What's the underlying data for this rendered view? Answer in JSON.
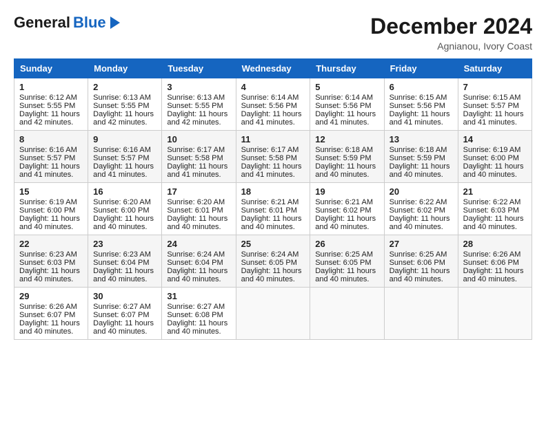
{
  "header": {
    "logo_general": "General",
    "logo_blue": "Blue",
    "month_title": "December 2024",
    "location": "Agnianou, Ivory Coast"
  },
  "days_of_week": [
    "Sunday",
    "Monday",
    "Tuesday",
    "Wednesday",
    "Thursday",
    "Friday",
    "Saturday"
  ],
  "weeks": [
    [
      {
        "day": "1",
        "sunrise": "6:12 AM",
        "sunset": "5:55 PM",
        "daylight": "11 hours and 42 minutes."
      },
      {
        "day": "2",
        "sunrise": "6:13 AM",
        "sunset": "5:55 PM",
        "daylight": "11 hours and 42 minutes."
      },
      {
        "day": "3",
        "sunrise": "6:13 AM",
        "sunset": "5:55 PM",
        "daylight": "11 hours and 42 minutes."
      },
      {
        "day": "4",
        "sunrise": "6:14 AM",
        "sunset": "5:56 PM",
        "daylight": "11 hours and 41 minutes."
      },
      {
        "day": "5",
        "sunrise": "6:14 AM",
        "sunset": "5:56 PM",
        "daylight": "11 hours and 41 minutes."
      },
      {
        "day": "6",
        "sunrise": "6:15 AM",
        "sunset": "5:56 PM",
        "daylight": "11 hours and 41 minutes."
      },
      {
        "day": "7",
        "sunrise": "6:15 AM",
        "sunset": "5:57 PM",
        "daylight": "11 hours and 41 minutes."
      }
    ],
    [
      {
        "day": "8",
        "sunrise": "6:16 AM",
        "sunset": "5:57 PM",
        "daylight": "11 hours and 41 minutes."
      },
      {
        "day": "9",
        "sunrise": "6:16 AM",
        "sunset": "5:57 PM",
        "daylight": "11 hours and 41 minutes."
      },
      {
        "day": "10",
        "sunrise": "6:17 AM",
        "sunset": "5:58 PM",
        "daylight": "11 hours and 41 minutes."
      },
      {
        "day": "11",
        "sunrise": "6:17 AM",
        "sunset": "5:58 PM",
        "daylight": "11 hours and 41 minutes."
      },
      {
        "day": "12",
        "sunrise": "6:18 AM",
        "sunset": "5:59 PM",
        "daylight": "11 hours and 40 minutes."
      },
      {
        "day": "13",
        "sunrise": "6:18 AM",
        "sunset": "5:59 PM",
        "daylight": "11 hours and 40 minutes."
      },
      {
        "day": "14",
        "sunrise": "6:19 AM",
        "sunset": "6:00 PM",
        "daylight": "11 hours and 40 minutes."
      }
    ],
    [
      {
        "day": "15",
        "sunrise": "6:19 AM",
        "sunset": "6:00 PM",
        "daylight": "11 hours and 40 minutes."
      },
      {
        "day": "16",
        "sunrise": "6:20 AM",
        "sunset": "6:00 PM",
        "daylight": "11 hours and 40 minutes."
      },
      {
        "day": "17",
        "sunrise": "6:20 AM",
        "sunset": "6:01 PM",
        "daylight": "11 hours and 40 minutes."
      },
      {
        "day": "18",
        "sunrise": "6:21 AM",
        "sunset": "6:01 PM",
        "daylight": "11 hours and 40 minutes."
      },
      {
        "day": "19",
        "sunrise": "6:21 AM",
        "sunset": "6:02 PM",
        "daylight": "11 hours and 40 minutes."
      },
      {
        "day": "20",
        "sunrise": "6:22 AM",
        "sunset": "6:02 PM",
        "daylight": "11 hours and 40 minutes."
      },
      {
        "day": "21",
        "sunrise": "6:22 AM",
        "sunset": "6:03 PM",
        "daylight": "11 hours and 40 minutes."
      }
    ],
    [
      {
        "day": "22",
        "sunrise": "6:23 AM",
        "sunset": "6:03 PM",
        "daylight": "11 hours and 40 minutes."
      },
      {
        "day": "23",
        "sunrise": "6:23 AM",
        "sunset": "6:04 PM",
        "daylight": "11 hours and 40 minutes."
      },
      {
        "day": "24",
        "sunrise": "6:24 AM",
        "sunset": "6:04 PM",
        "daylight": "11 hours and 40 minutes."
      },
      {
        "day": "25",
        "sunrise": "6:24 AM",
        "sunset": "6:05 PM",
        "daylight": "11 hours and 40 minutes."
      },
      {
        "day": "26",
        "sunrise": "6:25 AM",
        "sunset": "6:05 PM",
        "daylight": "11 hours and 40 minutes."
      },
      {
        "day": "27",
        "sunrise": "6:25 AM",
        "sunset": "6:06 PM",
        "daylight": "11 hours and 40 minutes."
      },
      {
        "day": "28",
        "sunrise": "6:26 AM",
        "sunset": "6:06 PM",
        "daylight": "11 hours and 40 minutes."
      }
    ],
    [
      {
        "day": "29",
        "sunrise": "6:26 AM",
        "sunset": "6:07 PM",
        "daylight": "11 hours and 40 minutes."
      },
      {
        "day": "30",
        "sunrise": "6:27 AM",
        "sunset": "6:07 PM",
        "daylight": "11 hours and 40 minutes."
      },
      {
        "day": "31",
        "sunrise": "6:27 AM",
        "sunset": "6:08 PM",
        "daylight": "11 hours and 40 minutes."
      },
      null,
      null,
      null,
      null
    ]
  ],
  "labels": {
    "sunrise": "Sunrise:",
    "sunset": "Sunset:",
    "daylight": "Daylight:"
  }
}
